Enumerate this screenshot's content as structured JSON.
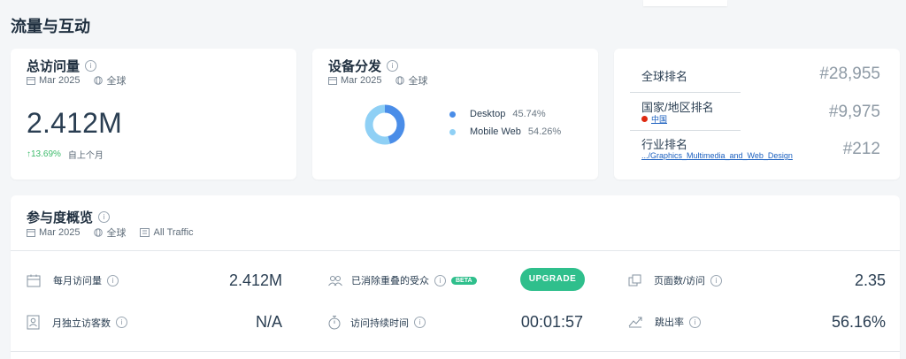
{
  "section_title": "流量与互动",
  "visits_card": {
    "title": "总访问量",
    "date": "Mar 2025",
    "region": "全球",
    "value": "2.412M",
    "change": "↑13.69%",
    "change_label": "自上个月"
  },
  "device_card": {
    "title": "设备分发",
    "date": "Mar 2025",
    "region": "全球",
    "segments": [
      {
        "label": "Desktop",
        "pct": "45.74%",
        "value": 45.74,
        "color": "#4a8de8"
      },
      {
        "label": "Mobile Web",
        "pct": "54.26%",
        "value": 54.26,
        "color": "#8fd0f5"
      }
    ]
  },
  "rank_card": {
    "global_label": "全球排名",
    "global_value": "#28,955",
    "country_label": "国家/地区排名",
    "country_link": "中国",
    "country_value": "#9,975",
    "industry_label": "行业排名",
    "industry_link": ".../Graphics_Multimedia_and_Web_Design",
    "industry_value": "#212"
  },
  "engagement": {
    "title": "参与度概览",
    "date": "Mar 2025",
    "region": "全球",
    "traffic": "All Traffic",
    "metrics": {
      "monthly_visits_label": "每月访问量",
      "monthly_visits_value": "2.412M",
      "dedup_label": "已消除重叠的受众",
      "beta": "BETA",
      "upgrade": "UPGRADE",
      "pages_label": "页面数/访问",
      "pages_value": "2.35",
      "unique_label": "月独立访客数",
      "unique_value": "N/A",
      "duration_label": "访问持续时间",
      "duration_value": "00:01:57",
      "bounce_label": "跳出率",
      "bounce_value": "56.16%"
    }
  }
}
